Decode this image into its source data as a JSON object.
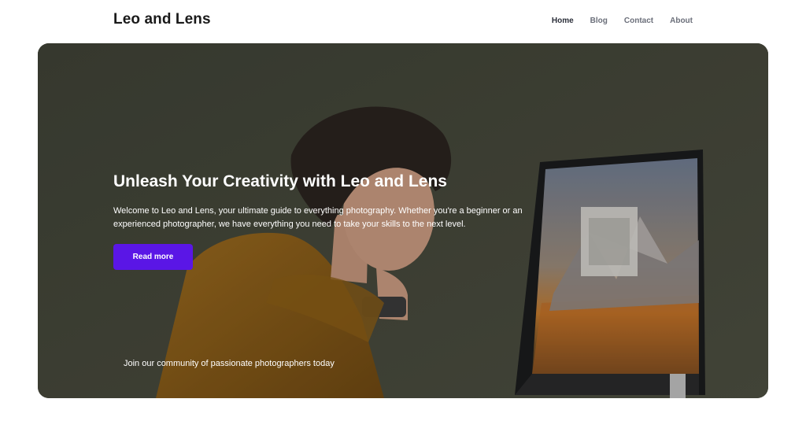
{
  "header": {
    "brand": "Leo and Lens",
    "nav": [
      {
        "label": "Home",
        "active": true
      },
      {
        "label": "Blog",
        "active": false
      },
      {
        "label": "Contact",
        "active": false
      },
      {
        "label": "About",
        "active": false
      }
    ]
  },
  "hero": {
    "title": "Unleash Your Creativity with Leo and Lens",
    "description": "Welcome to Leo and Lens, your ultimate guide to everything photography. Whether you're a beginner or an experienced photographer, we have everything you need to take your skills to the next level.",
    "cta_label": "Read more",
    "footnote": "Join our community of passionate photographers today",
    "image_subject": "man-at-computer-photo"
  },
  "colors": {
    "accent": "#5a16e6",
    "hero_overlay": "#4a4c3f",
    "nav_active": "#2b2f3a",
    "nav_inactive": "#6b6f7a"
  }
}
